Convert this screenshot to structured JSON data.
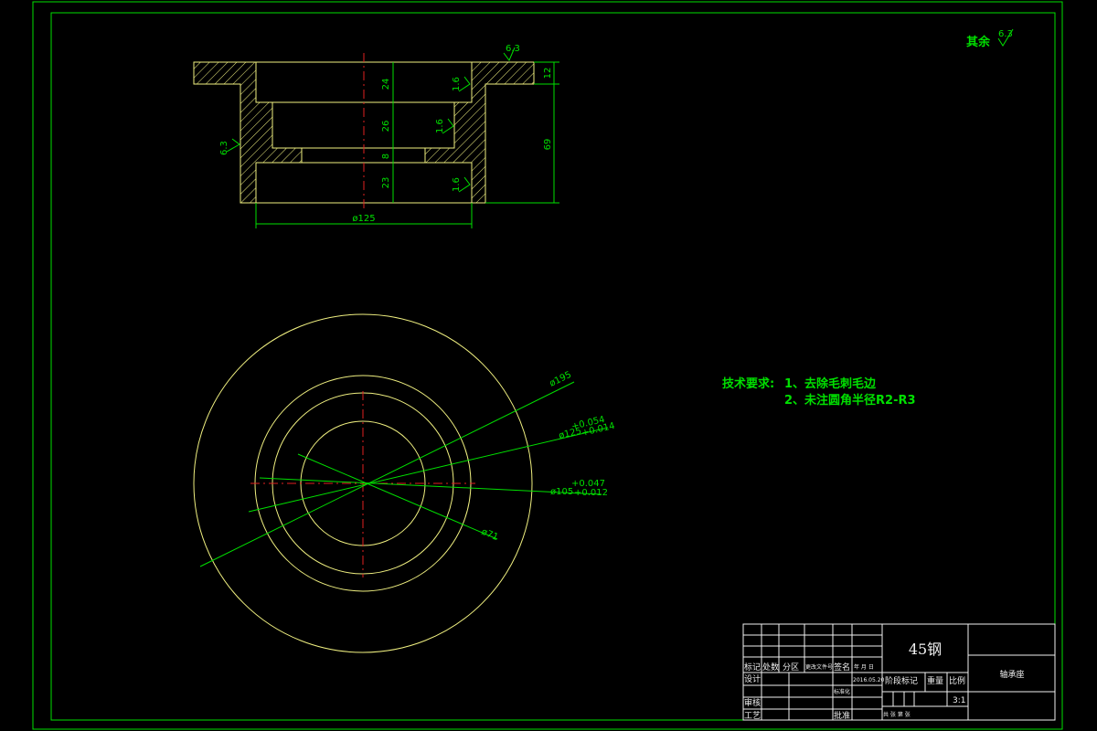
{
  "surface_finish": {
    "rest_label": "其余",
    "rest_value": "6.3",
    "top_value": "6.3",
    "left_value": "6.3",
    "bore_values": [
      "1.6",
      "1.6",
      "1.6"
    ]
  },
  "section_view": {
    "dimensions": {
      "h1": "24",
      "h2": "26",
      "h3": "8",
      "h4": "23",
      "flange": "12",
      "total": "69",
      "width": "ø125"
    }
  },
  "front_view": {
    "dimensions": {
      "d195": "ø195",
      "d125": "ø125",
      "d125_tol_up": "+0.054",
      "d125_tol_low": "+0.014",
      "d105": "ø105",
      "d105_tol_up": "+0.047",
      "d105_tol_low": "+0.012",
      "d71": "ø71"
    }
  },
  "tech_requirements": {
    "title": "技术要求:",
    "item1": "1、去除毛刺毛边",
    "item2": "2、未注圆角半径R2-R3"
  },
  "title_block": {
    "material": "45钢",
    "part_name": "轴承座",
    "headers": {
      "mark": "标记",
      "count": "处数",
      "zone": "分区",
      "doc_no": "更改文件号",
      "sign": "签名",
      "date": "年 月 日"
    },
    "design": "设计",
    "standardize": "标准化",
    "design_date": "2016.05.20",
    "review": "审核",
    "process": "工艺",
    "approve": "批准",
    "stage_mark": "阶段标记",
    "weight": "重量",
    "scale_label": "比例",
    "scale": "3:1",
    "sheets": "共 张 第 张"
  }
}
